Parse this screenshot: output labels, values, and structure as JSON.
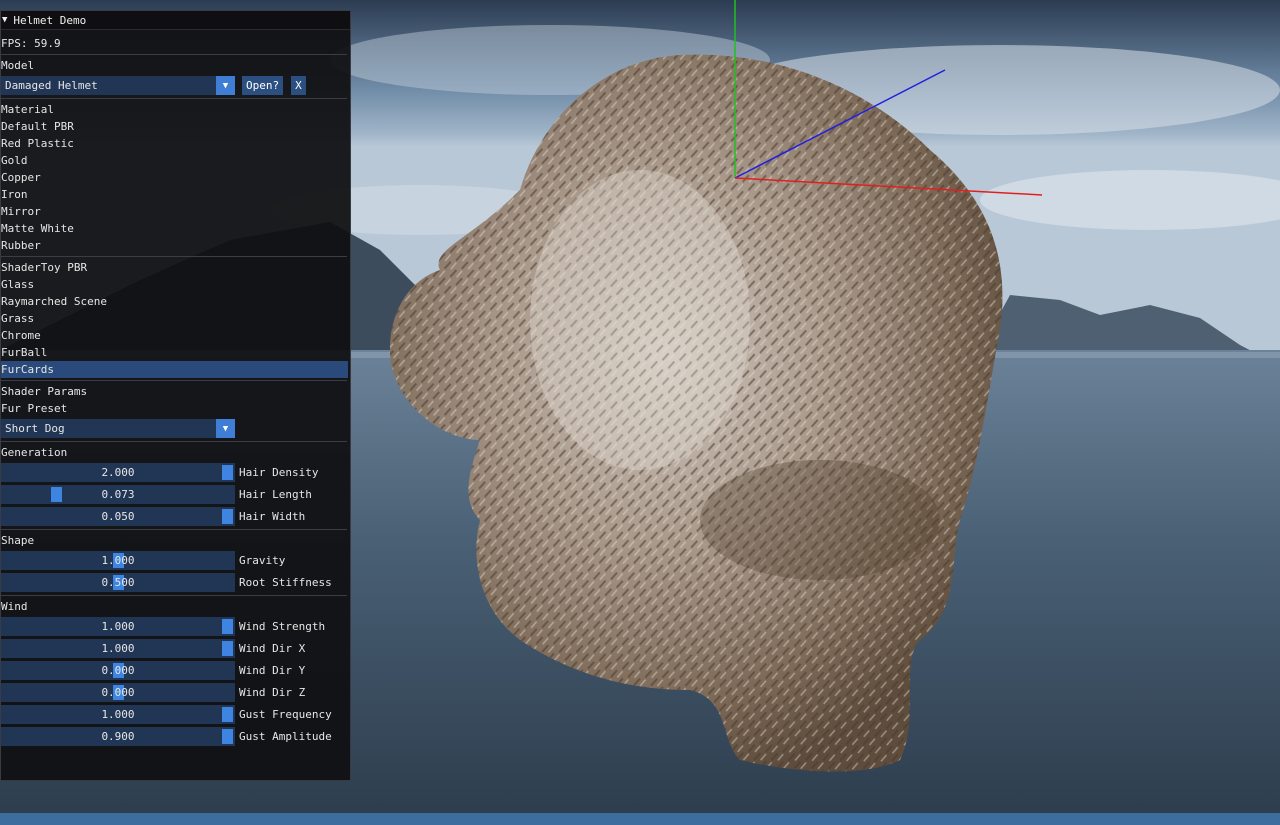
{
  "window": {
    "title": "Helmet Demo",
    "collapse_arrow": "▼",
    "fps": "FPS: 59.9"
  },
  "model": {
    "header": "Model",
    "selected": "Damaged Helmet",
    "open_label": "Open?",
    "close_label": "X"
  },
  "material": {
    "header": "Material",
    "items": [
      "Default PBR",
      "Red Plastic",
      "Gold",
      "Copper",
      "Iron",
      "Mirror",
      "Matte White",
      "Rubber"
    ]
  },
  "shadertoy": {
    "items": [
      "ShaderToy PBR",
      "Glass",
      "Raymarched Scene",
      "Grass",
      "Chrome",
      "FurBall",
      "FurCards"
    ],
    "selected_index": 6
  },
  "shader_params": {
    "header": "Shader Params",
    "preset_label": "Fur Preset",
    "preset_value": "Short Dog"
  },
  "generation": {
    "header": "Generation",
    "sliders": [
      {
        "label": "Hair Density",
        "value": "2.000",
        "fraction": 1.0
      },
      {
        "label": "Hair Length",
        "value": "0.073",
        "fraction": 0.22
      },
      {
        "label": "Hair Width",
        "value": "0.050",
        "fraction": 1.0
      }
    ]
  },
  "shape": {
    "header": "Shape",
    "sliders": [
      {
        "label": "Gravity",
        "value": "1.000",
        "fraction": 0.5
      },
      {
        "label": "Root Stiffness",
        "value": "0.500",
        "fraction": 0.5
      }
    ]
  },
  "wind": {
    "header": "Wind",
    "sliders": [
      {
        "label": "Wind Strength",
        "value": "1.000",
        "fraction": 1.0
      },
      {
        "label": "Wind Dir X",
        "value": "1.000",
        "fraction": 1.0
      },
      {
        "label": "Wind Dir Y",
        "value": "0.000",
        "fraction": 0.5
      },
      {
        "label": "Wind Dir Z",
        "value": "0.000",
        "fraction": 0.5
      },
      {
        "label": "Gust Frequency",
        "value": "1.000",
        "fraction": 1.0
      },
      {
        "label": "Gust Amplitude",
        "value": "0.900",
        "fraction": 1.0
      }
    ]
  },
  "colors": {
    "window_bg": "#101012",
    "frame_bg": "#213555",
    "accent": "#3d85e0",
    "selected_bg": "#294a7a",
    "axis_x": "#e02020",
    "axis_y": "#20c020",
    "axis_z": "#2020e0"
  }
}
